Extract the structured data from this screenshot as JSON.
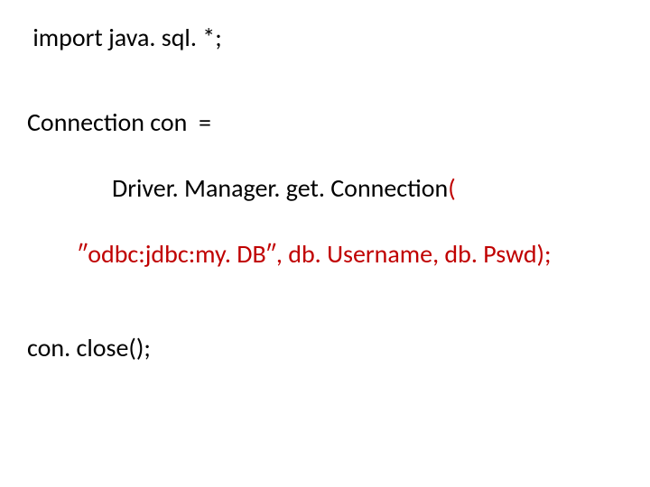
{
  "code": {
    "line1": " import java. sql. *;",
    "line2": "Connection con  =",
    "line3_prefix": "Driver. Manager. get. Connection",
    "line3_suffix": "(",
    "line4": "″odbc:jdbc:my. DB″, db. Username, db. Pswd);",
    "line5": "con. close();"
  }
}
